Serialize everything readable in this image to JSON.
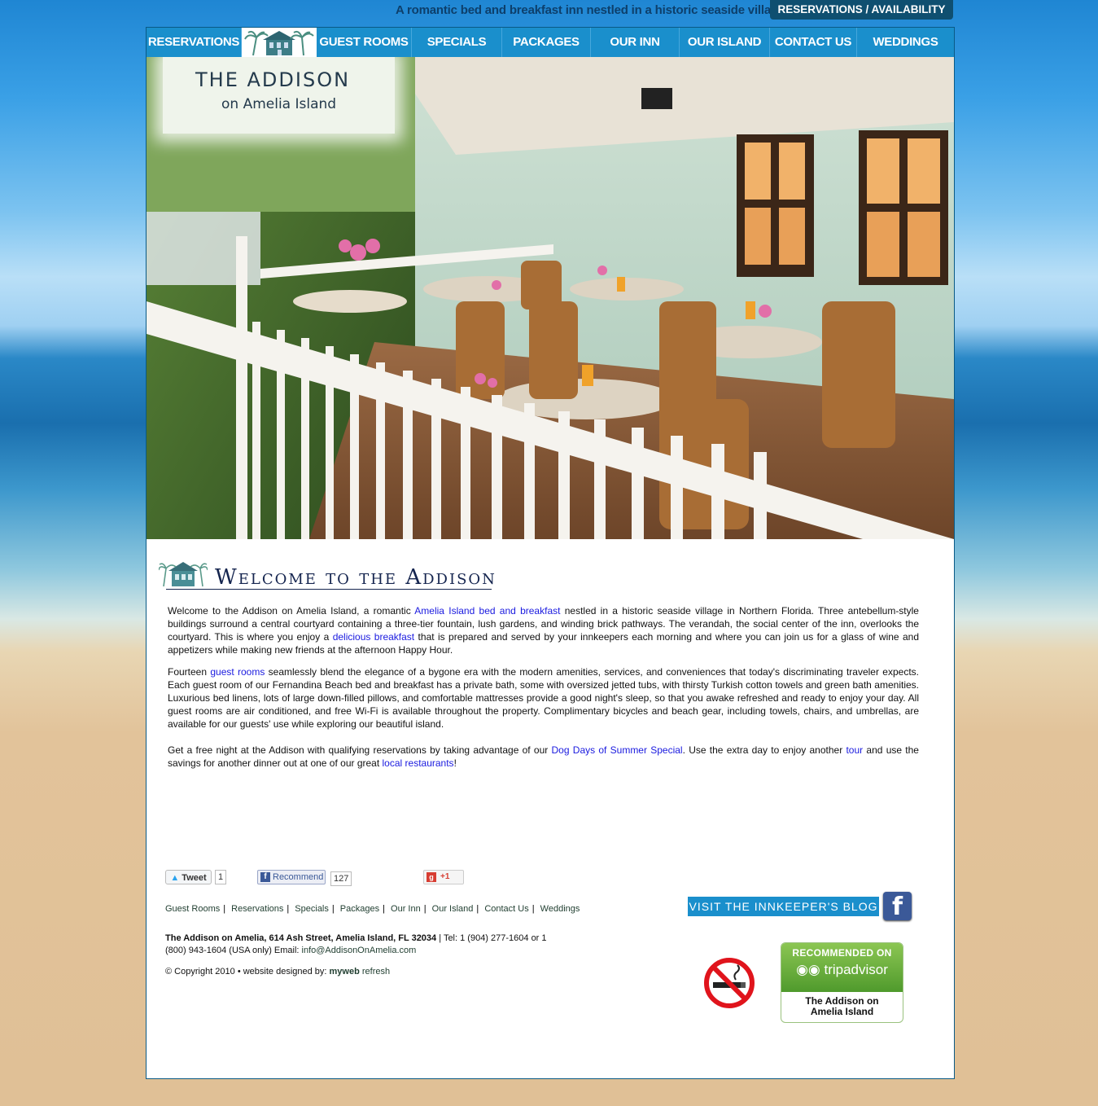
{
  "header": {
    "tagline": "A romantic bed and breakfast inn nestled in a historic seaside village",
    "reservations_availability": "RESERVATIONS / AVAILABILITY"
  },
  "nav": [
    {
      "label": "RESERVATIONS"
    },
    {
      "label": "GUEST ROOMS"
    },
    {
      "label": "SPECIALS"
    },
    {
      "label": "PACKAGES"
    },
    {
      "label": "OUR INN"
    },
    {
      "label": "OUR ISLAND"
    },
    {
      "label": "CONTACT US"
    },
    {
      "label": "WEDDINGS"
    }
  ],
  "logo": {
    "title": "THE ADDISON",
    "subtitle": "on Amelia Island"
  },
  "welcome": {
    "title": "Welcome to the Addison",
    "p1": {
      "a": "Welcome to the Addison on Amelia Island, a romantic ",
      "link1": "Amelia Island bed and breakfast",
      "b": " nestled in a historic seaside village in Northern Florida. Three antebellum-style buildings surround a central courtyard containing a three-tier fountain, lush gardens, and winding brick pathways. The verandah, the social center of the inn, overlooks the courtyard. This is where you enjoy a ",
      "link2": "delicious breakfast",
      "c": " that is prepared and served by your innkeepers each morning and where you can join us for a glass of wine and appetizers while making new friends at the afternoon Happy Hour."
    },
    "p2": {
      "a": "Fourteen ",
      "link1": "guest rooms",
      "b": " seamlessly blend the elegance of a bygone era with the modern amenities, services, and conveniences that today's discriminating traveler expects. Each guest room of our Fernandina Beach bed and breakfast has a private bath, some with oversized jetted tubs, with thirsty Turkish cotton towels and green bath amenities. Luxurious bed linens, lots of large down-filled pillows, and comfortable mattresses provide a good night's sleep, so that you awake refreshed and ready to enjoy your day. All guest rooms are air conditioned, and free Wi-Fi is available throughout the property. Complimentary bicycles and beach gear, including towels, chairs, and umbrellas, are available for our guests' use while exploring our beautiful island."
    },
    "p3": {
      "a": "Get a free night at the Addison with qualifying reservations by taking advantage of our ",
      "link1": "Dog Days of Summer Special",
      "b": ".  Use the extra day to enjoy another ",
      "link2": "tour",
      "c": " and use the savings for another dinner out at one of our great ",
      "link3": "local restaurants",
      "d": "!"
    }
  },
  "social": {
    "tweet_label": "Tweet",
    "tweet_count": "1",
    "recommend_label": "Recommend",
    "recommend_count": "127",
    "gplus_label": "+1"
  },
  "footer": {
    "links": [
      "Guest Rooms",
      "Reservations",
      "Specials",
      "Packages",
      "Our Inn",
      "Our Island",
      "Contact Us",
      "Weddings"
    ],
    "address_bold": "The Addison on Amelia, 614 Ash Street, Amelia Island, FL 32034",
    "address_rest": " | Tel: 1 (904) 277-1604 or 1 (800) 943-1604 (USA only) Email: ",
    "email": "info@AddisonOnAmelia.com",
    "copyright": "© Copyright 2010 • website designed by: ",
    "designer_a": "myweb",
    "designer_b": " refresh",
    "blog_button": "VISIT THE INNKEEPER'S BLOG",
    "tripadvisor_recommended": "RECOMMENDED ON",
    "tripadvisor_logo": "tripadvisor",
    "tripadvisor_name": "The Addison on Amelia Island"
  },
  "colors": {
    "nav_bg": "#1a8fcc",
    "link": "#1a1adf",
    "title": "#15254f"
  }
}
